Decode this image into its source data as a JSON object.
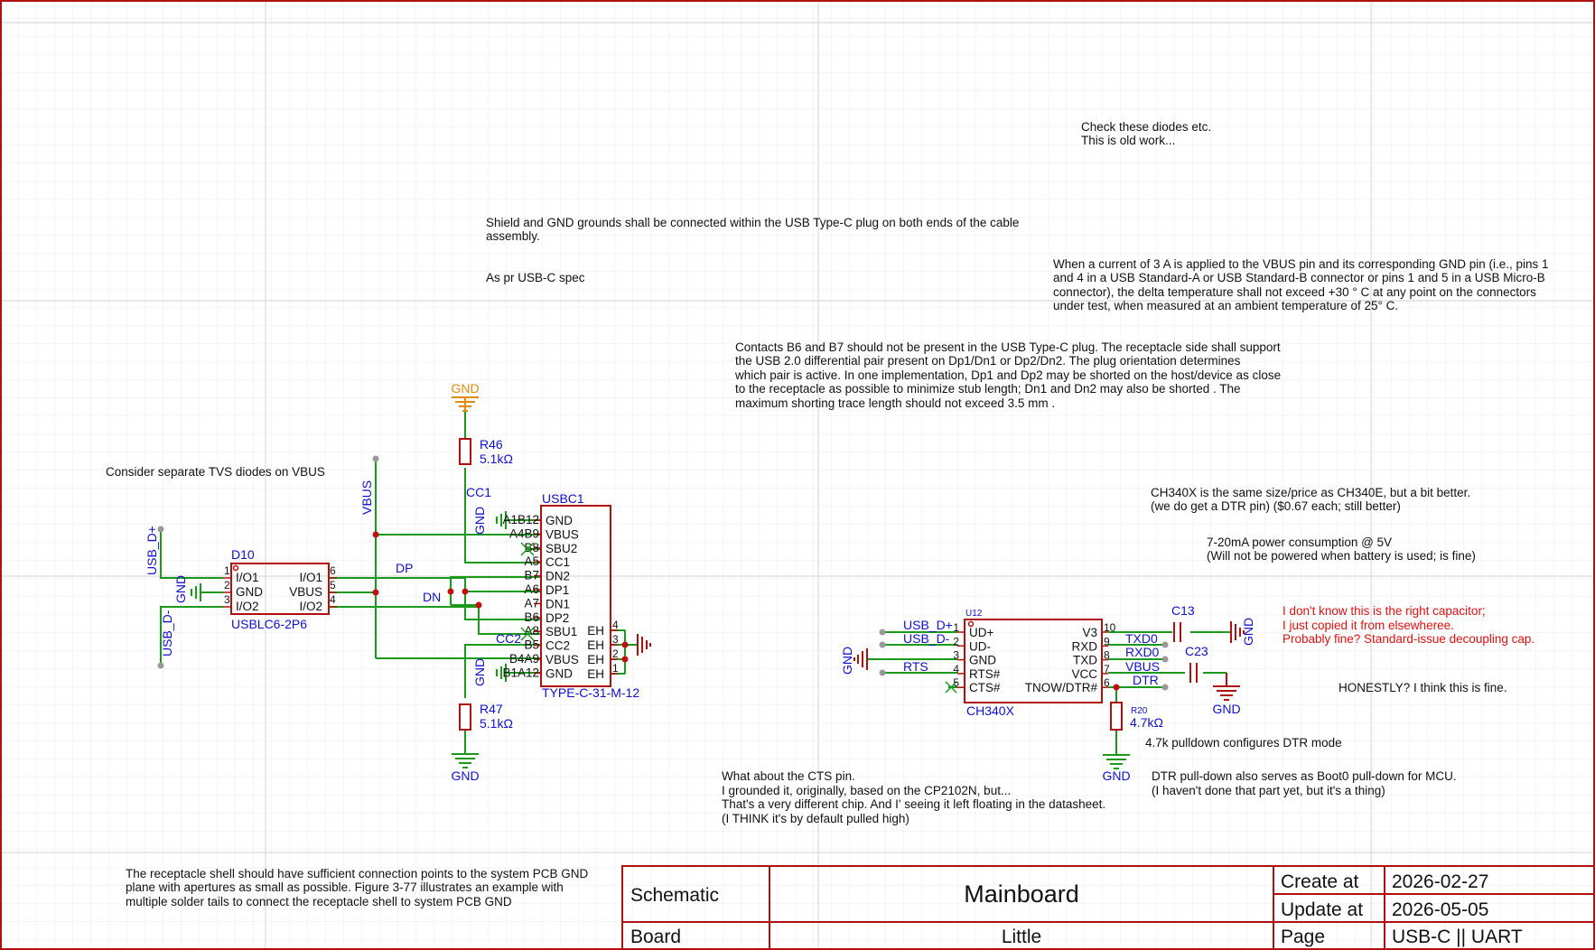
{
  "notes": {
    "check_diodes": [
      "Check these diodes etc.",
      "This is old work..."
    ],
    "shield": [
      "Shield and GND grounds shall be connected within the USB Type-C plug on both ends of the cable",
      "assembly."
    ],
    "as_pr": "As pr USB-C spec",
    "current": [
      "When a current of 3 A is applied to the VBUS pin and its corresponding GND pin (i.e., pins 1",
      "and 4 in a USB Standard-A or USB Standard-B connector or pins 1 and 5 in a USB Micro-B",
      "connector), the delta temperature shall not exceed +30 ° C at any point on the connectors",
      "under test, when measured at an ambient temperature of 25° C."
    ],
    "contacts": [
      "Contacts B6 and B7 should not be present in the USB Type-C plug. The receptacle side shall support",
      "the USB 2.0 differential pair present on Dp1/Dn1 or Dp2/Dn2. The plug orientation determines",
      "which pair is active. In one implementation, Dp1 and Dp2 may be shorted on the host/device as close",
      "to the receptacle as possible to minimize stub length; Dn1 and Dn2 may also be shorted . The",
      "maximum shorting trace length should not exceed 3.5 mm ."
    ],
    "tvs": "Consider separate TVS diodes on VBUS",
    "ch340x": [
      "CH340X is the same size/price as CH340E, but a bit better.",
      "(we do get a DTR pin) ($0.67 each; still better)"
    ],
    "power": [
      "7-20mA power consumption @ 5V",
      "(Will not be powered when battery is used; is fine)"
    ],
    "capacitor": [
      "I don't know this is the right capacitor;",
      "I just copied it from elsewheree.",
      "Probably fine? Standard-issue decoupling cap."
    ],
    "honestly": "HONESTLY? I think this is fine.",
    "pulldown": "4.7k pulldown configures DTR mode",
    "cts": [
      "What about the CTS pin.",
      "I grounded it, originally, based on the CP2102N, but...",
      "That's a very different chip. And I' seeing it left floating in the datasheet.",
      "(I THINK it's by default pulled high)"
    ],
    "boot0": [
      "DTR pull-down also serves as Boot0 pull-down for MCU.",
      "(I haven't done that part yet, but it's a thing)"
    ],
    "shell": [
      "The receptacle shell should have sufficient connection points to the system PCB GND",
      "plane with apertures as small as possible. Figure 3-77 illustrates an example with",
      "multiple solder tails to connect the receptacle shell to system PCB GND"
    ]
  },
  "nets": {
    "gnd": "GND",
    "vbus": "VBUS",
    "cc1": "CC1",
    "cc2": "CC2",
    "dp": "DP",
    "dn": "DN",
    "usb_dp": "USB_D+",
    "usb_dm": "USB_D-",
    "txd0": "TXD0",
    "rxd0": "RXD0",
    "dtr": "DTR",
    "rts": "RTS"
  },
  "components": {
    "r46": {
      "ref": "R46",
      "value": "5.1kΩ"
    },
    "r47": {
      "ref": "R47",
      "value": "5.1kΩ"
    },
    "r20": {
      "ref": "R20",
      "value": "4.7kΩ"
    },
    "c13": {
      "ref": "C13"
    },
    "c23": {
      "ref": "C23"
    },
    "d10": {
      "ref": "D10",
      "part": "USBLC6-2P6",
      "left_pins": [
        {
          "num": "1",
          "name": "I/O1"
        },
        {
          "num": "2",
          "name": "GND"
        },
        {
          "num": "3",
          "name": "I/O2"
        }
      ],
      "right_pins": [
        {
          "num": "6",
          "name": "I/O1"
        },
        {
          "num": "5",
          "name": "VBUS"
        },
        {
          "num": "4",
          "name": "I/O2"
        }
      ]
    },
    "usbc1": {
      "ref": "USBC1",
      "part": "TYPE-C-31-M-12",
      "pins": [
        {
          "num": "A1B12",
          "name": "GND"
        },
        {
          "num": "A4B9",
          "name": "VBUS"
        },
        {
          "num": "B8",
          "name": "SBU2"
        },
        {
          "num": "A5",
          "name": "CC1"
        },
        {
          "num": "B7",
          "name": "DN2"
        },
        {
          "num": "A6",
          "name": "DP1"
        },
        {
          "num": "A7",
          "name": "DN1"
        },
        {
          "num": "B6",
          "name": "DP2"
        },
        {
          "num": "A8",
          "name": "SBU1"
        },
        {
          "num": "B5",
          "name": "CC2"
        },
        {
          "num": "B4A9",
          "name": "VBUS"
        },
        {
          "num": "B1A12",
          "name": "GND"
        }
      ],
      "eh_pins": [
        {
          "num": "4",
          "name": "EH"
        },
        {
          "num": "3",
          "name": "EH"
        },
        {
          "num": "2",
          "name": "EH"
        },
        {
          "num": "1",
          "name": "EH"
        }
      ]
    },
    "u12": {
      "ref": "U12",
      "part": "CH340X",
      "left_pins": [
        {
          "num": "1",
          "name": "UD+"
        },
        {
          "num": "2",
          "name": "UD-"
        },
        {
          "num": "3",
          "name": "GND"
        },
        {
          "num": "4",
          "name": "RTS#"
        },
        {
          "num": "5",
          "name": "CTS#"
        }
      ],
      "right_pins": [
        {
          "num": "10",
          "name": "V3"
        },
        {
          "num": "9",
          "name": "RXD"
        },
        {
          "num": "8",
          "name": "TXD"
        },
        {
          "num": "7",
          "name": "VCC"
        },
        {
          "num": "6",
          "name": "TNOW/DTR#"
        }
      ]
    }
  },
  "title_block": {
    "schematic_label": "Schematic",
    "title": "Mainboard",
    "board_label": "Board",
    "board": "Little",
    "create_label": "Create at",
    "create_date": "2026-02-27",
    "update_label": "Update at",
    "update_date": "2026-05-05",
    "page_label": "Page",
    "page": "USB-C || UART"
  },
  "colors": {
    "wire": "#1a9a1a",
    "component": "#b01010",
    "net_label": "#1010d0",
    "gnd_top": "#e08a10",
    "warning": "#e01010"
  }
}
